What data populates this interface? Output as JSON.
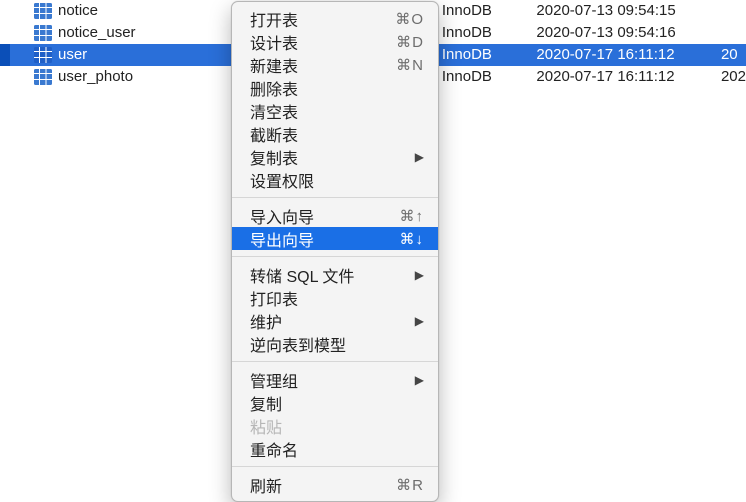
{
  "tables": [
    {
      "name": "notice",
      "engine": "InnoDB",
      "date": "2020-07-13 09:54:15",
      "extra": "",
      "indent": 1,
      "selected": false
    },
    {
      "name": "notice_user",
      "engine": "InnoDB",
      "date": "2020-07-13 09:54:16",
      "extra": "",
      "indent": 2,
      "selected": false
    },
    {
      "name": "user",
      "engine": "InnoDB",
      "date": "2020-07-17 16:11:12",
      "extra": "20",
      "indent": 2,
      "selected": true
    },
    {
      "name": "user_photo",
      "engine": "InnoDB",
      "date": "2020-07-17 16:11:12",
      "extra": "202",
      "indent": 2,
      "selected": false
    }
  ],
  "menu": {
    "items": [
      {
        "label": "打开表",
        "shortcut": "⌘O"
      },
      {
        "label": "设计表",
        "shortcut": "⌘D"
      },
      {
        "label": "新建表",
        "shortcut": "⌘N"
      },
      {
        "label": "删除表"
      },
      {
        "label": "清空表"
      },
      {
        "label": "截断表"
      },
      {
        "label": "复制表",
        "submenu": true
      },
      {
        "label": "设置权限"
      },
      {
        "sep": true
      },
      {
        "label": "导入向导",
        "shortcut": "⌘↑"
      },
      {
        "label": "导出向导",
        "shortcut": "⌘↓",
        "highlight": true
      },
      {
        "sep": true
      },
      {
        "label": "转储 SQL 文件",
        "submenu": true
      },
      {
        "label": "打印表"
      },
      {
        "label": "维护",
        "submenu": true
      },
      {
        "label": "逆向表到模型"
      },
      {
        "sep": true
      },
      {
        "label": "管理组",
        "submenu": true
      },
      {
        "label": "复制"
      },
      {
        "label": "粘贴",
        "disabled": true
      },
      {
        "label": "重命名"
      },
      {
        "sep": true
      },
      {
        "label": "刷新",
        "shortcut": "⌘R"
      }
    ]
  }
}
